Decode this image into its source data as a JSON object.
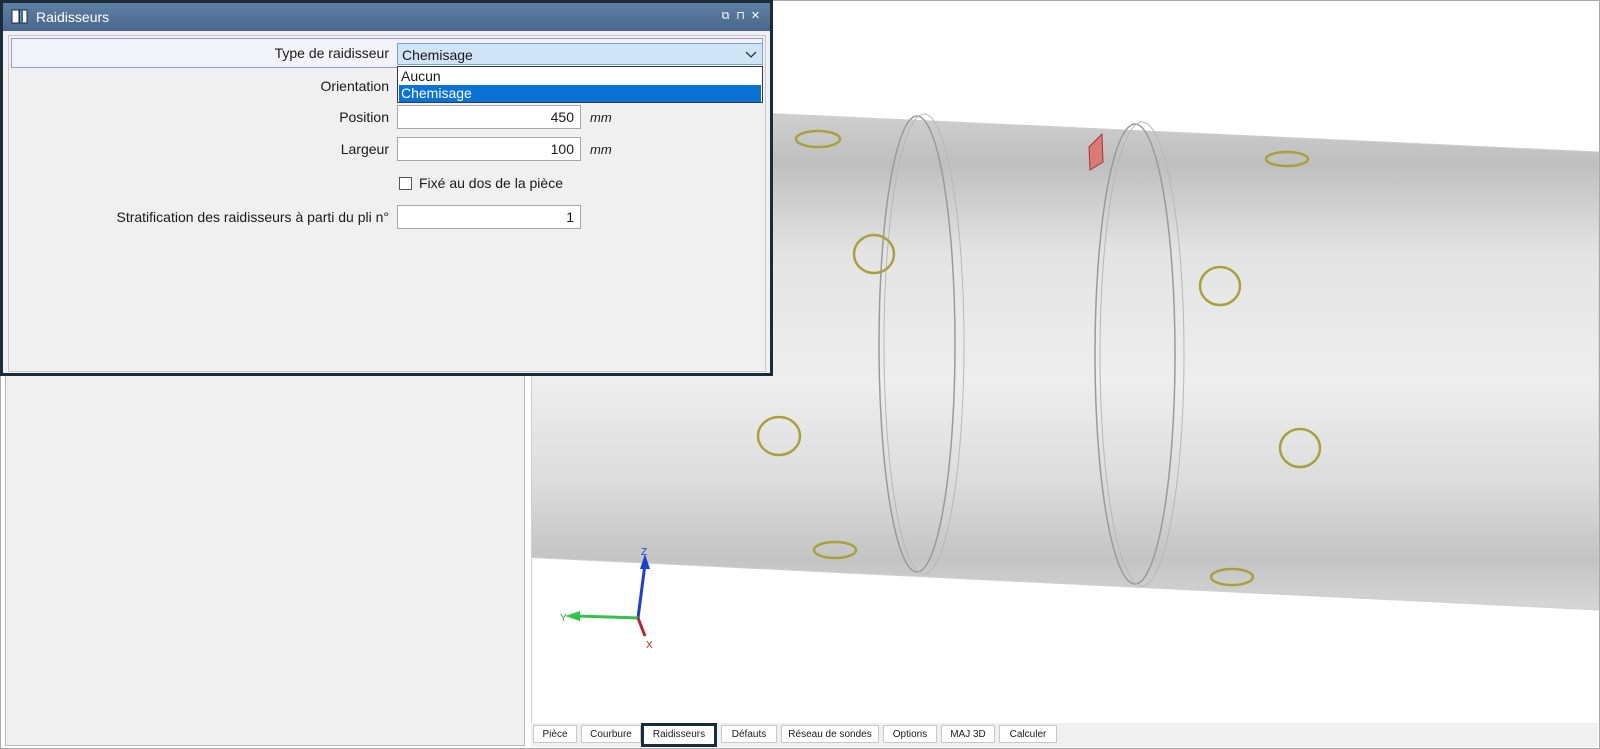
{
  "window": {
    "title": "Raidisseurs",
    "buttons": {
      "restore": "⧉",
      "pin": "⊓",
      "close": "✕"
    }
  },
  "form": {
    "type_label": "Type de raidisseur",
    "type_value": "Chemisage",
    "type_options": [
      "Aucun",
      "Chemisage"
    ],
    "orientation_label": "Orientation",
    "position_label": "Position",
    "position_value": "450",
    "position_unit": "mm",
    "largeur_label": "Largeur",
    "largeur_value": "100",
    "largeur_unit": "mm",
    "fixed_checkbox_label": "Fixé au dos de la pièce",
    "fixed_checked": false,
    "stratification_label": "Stratification des raidisseurs à parti du pli n°",
    "stratification_value": "1"
  },
  "axes": {
    "z": "Z",
    "y": "Y",
    "x": "X"
  },
  "tabs": [
    {
      "label": "Pièce",
      "active": false
    },
    {
      "label": "Courbure",
      "active": false
    },
    {
      "label": "Raidisseurs",
      "active": true
    },
    {
      "label": "Défauts",
      "active": false
    },
    {
      "label": "Réseau de sondes",
      "active": false
    },
    {
      "label": "Options",
      "active": false
    },
    {
      "label": "MAJ 3D",
      "active": false
    },
    {
      "label": "Calculer",
      "active": false
    }
  ],
  "colors": {
    "title_bar": "#48678c",
    "selection": "#0a72d4",
    "probe_ring": "#a8a23a",
    "defect": "#d9534f"
  }
}
